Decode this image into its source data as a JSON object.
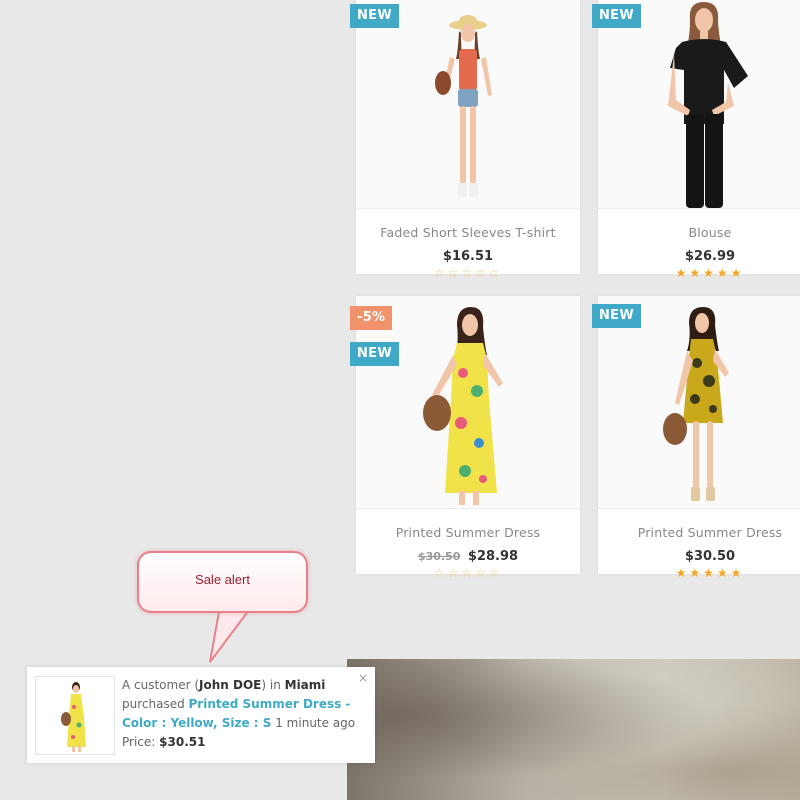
{
  "products": [
    {
      "name": "Faded Short Sleeves T-shirt",
      "price": "$16.51",
      "old_price": "",
      "badges": [
        "NEW"
      ],
      "rating": 0
    },
    {
      "name": "Blouse",
      "price": "$26.99",
      "old_price": "",
      "badges": [
        "NEW"
      ],
      "rating": 5
    },
    {
      "name": "Printed Summer Dress",
      "price": "$28.98",
      "old_price": "$30.50",
      "badges": [
        "-5%",
        "NEW"
      ],
      "rating": 0
    },
    {
      "name": "Printed Summer Dress",
      "price": "$30.50",
      "old_price": "",
      "badges": [
        "NEW"
      ],
      "rating": 5
    }
  ],
  "annotation": {
    "label": "Sale alert"
  },
  "notification": {
    "prefix": "A customer (",
    "customer": "John DOE",
    "in_text": ") in ",
    "city": "Miami",
    "purchased_text": "purchased ",
    "product": "Printed Summer Dress -",
    "options": "Color : Yellow, Size : S",
    "time": " 1 minute ago",
    "price_label": "Price: ",
    "price": "$30.51",
    "close_icon": "×"
  },
  "colors": {
    "new_badge": "#3fa9c7",
    "sale_badge": "#f0926b",
    "star": "#f5a623",
    "link": "#3fa9c7"
  }
}
